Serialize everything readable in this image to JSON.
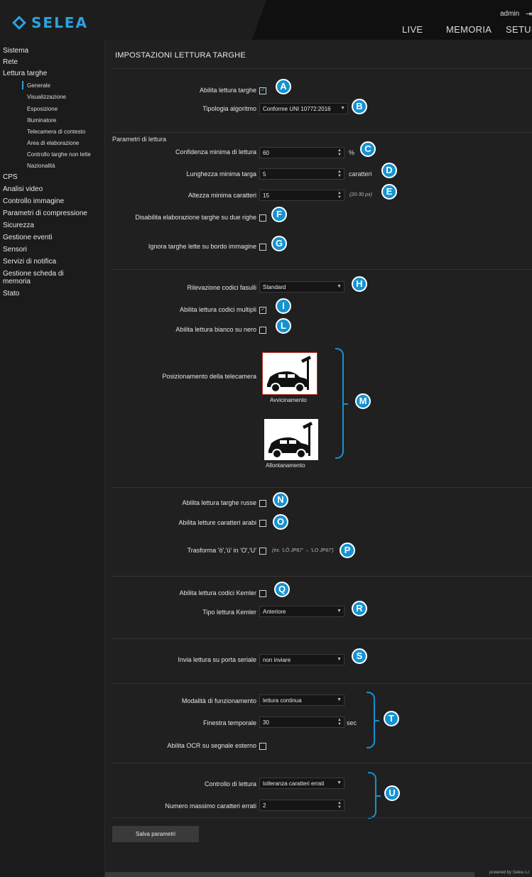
{
  "app": {
    "logo_text": "SELEA",
    "user": "admin",
    "logout_icon": "logout-icon"
  },
  "nav": {
    "live": "LIVE",
    "memoria": "MEMORIA",
    "setup": "SETUP"
  },
  "sidebar": {
    "sistema": "Sistema",
    "rete": "Rete",
    "lettura_targhe": "Lettura targhe",
    "sub": {
      "generale": "Generale",
      "visualizzazione": "Visualizzazione",
      "esposizione": "Esposizione",
      "illuminatore": "Illuminatore",
      "telecamera": "Telecamera di contesto",
      "area": "Area di elaborazione",
      "controllo": "Controllo targhe non lette",
      "nazionalita": "Nazionalità"
    },
    "cps": "CPS",
    "analisi": "Analisi video",
    "controllo_immagine": "Controllo immagine",
    "compressione": "Parametri di compressione",
    "sicurezza": "Sicurezza",
    "eventi": "Gestione eventi",
    "sensori": "Sensori",
    "notifica": "Servizi di notifica",
    "scheda_1": "Gestione scheda di",
    "scheda_2": "memoria",
    "stato": "Stato"
  },
  "main": {
    "title": "IMPOSTAZIONI LETTURA TARGHE",
    "abilita_lettura": "Abilita lettura targhe",
    "tipologia": "Tipologia algoritmo",
    "tipologia_value": "Conforme UNI 10772:2016",
    "parametri_lettura": "Parametri di lettura",
    "confidenza": "Confidenza minima di lettura",
    "confidenza_value": "60",
    "confidenza_unit": "%",
    "lunghezza": "Lunghezza minima targa",
    "lunghezza_value": "5",
    "lunghezza_unit": "caratteri",
    "altezza": "Altezza minima caratteri",
    "altezza_value": "15",
    "altezza_hint": "(20-30 px)",
    "disabilita_righe": "Disabilita elaborazione targhe su due righe",
    "ignora_bordo": "Ignora targhe lette su bordo immagine",
    "rilevazione": "Rilevazione codici fasulli",
    "rilevazione_value": "Standard",
    "multipli": "Abilita lettura codici multipli",
    "bianco_nero": "Abilita lettura bianco su nero",
    "posizionamento": "Posizionamento della telecamera",
    "avvicinamento": "Avvicinamento",
    "allontanamento": "Allontanamento",
    "russe": "Abilita lettura targhe russe",
    "arabi": "Abilita letture caratteri arabi",
    "trasforma": "Trasforma 'ö','ü' in 'O','U'",
    "trasforma_hint": "(ex. 'LÖ JP67' → 'LO JP67')",
    "kemler": "Abilita lettura codici Kemler",
    "tipo_kemler": "Tipo lettura Kemler",
    "tipo_kemler_value": "Anteriore",
    "seriale": "Invia lettura su porta seriale",
    "seriale_value": "non inviare",
    "modalita": "Modalità di funzionamento",
    "modalita_value": "lettura continua",
    "finestra": "Finestra temporale",
    "finestra_value": "30",
    "finestra_unit": "sec",
    "ocr": "Abilita OCR su segnale esterno",
    "controllo_lettura": "Controllo di lettura",
    "controllo_lettura_value": "tolleranza caratteri errati",
    "max_errati": "Numero massimo caratteri errati",
    "max_errati_value": "2",
    "save": "Salva parametri",
    "powered": "powered by Selea s.r."
  },
  "badges": [
    "A",
    "B",
    "C",
    "D",
    "E",
    "F",
    "G",
    "H",
    "I",
    "L",
    "M",
    "N",
    "O",
    "P",
    "Q",
    "R",
    "S",
    "T",
    "U"
  ],
  "colors": {
    "accent": "#2ba3e0",
    "badge": "#1592d2"
  }
}
